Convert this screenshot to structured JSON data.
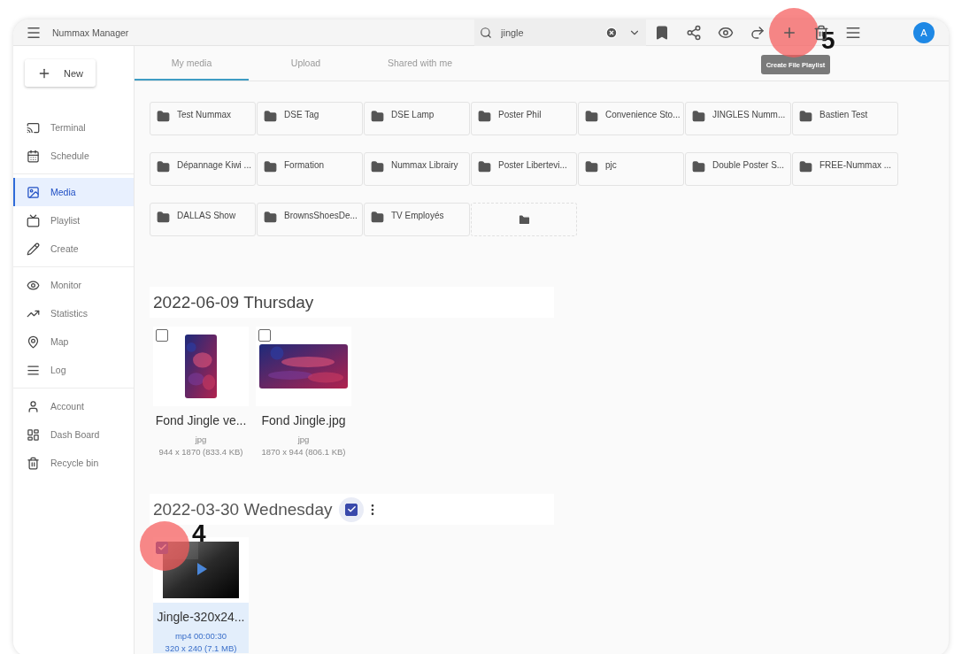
{
  "app": {
    "title": "Nummax Manager"
  },
  "search": {
    "value": "jingle"
  },
  "toolbar": {
    "avatar": "A",
    "tooltip": "Create File Playlist"
  },
  "new_button": {
    "label": "New"
  },
  "sidebar": {
    "groups": [
      {
        "items": [
          {
            "label": "Terminal",
            "selected": false
          },
          {
            "label": "Schedule",
            "selected": false
          }
        ]
      },
      {
        "items": [
          {
            "label": "Media",
            "selected": true
          },
          {
            "label": "Playlist",
            "selected": false
          },
          {
            "label": "Create",
            "selected": false
          }
        ]
      },
      {
        "items": [
          {
            "label": "Monitor",
            "selected": false
          },
          {
            "label": "Statistics",
            "selected": false
          },
          {
            "label": "Map",
            "selected": false
          },
          {
            "label": "Log",
            "selected": false
          }
        ]
      },
      {
        "items": [
          {
            "label": "Account",
            "selected": false
          },
          {
            "label": "Dash Board",
            "selected": false
          },
          {
            "label": "Recycle bin",
            "selected": false
          }
        ]
      }
    ]
  },
  "tabs": [
    {
      "label": "My media",
      "selected": true
    },
    {
      "label": "Upload",
      "selected": false
    },
    {
      "label": "Shared with me",
      "selected": false
    }
  ],
  "folders": [
    {
      "name": "Test Nummax"
    },
    {
      "name": "DSE Tag"
    },
    {
      "name": "DSE Lamp"
    },
    {
      "name": "Poster Phil"
    },
    {
      "name": "Convenience Sto..."
    },
    {
      "name": "JINGLES Numm..."
    },
    {
      "name": "Bastien Test"
    },
    {
      "name": "Dépannage Kiwi ..."
    },
    {
      "name": "Formation"
    },
    {
      "name": "Nummax Librairy"
    },
    {
      "name": "Poster Libertevi..."
    },
    {
      "name": "pjc"
    },
    {
      "name": "Double Poster S..."
    },
    {
      "name": "FREE-Nummax ..."
    },
    {
      "name": "DALLAS Show"
    },
    {
      "name": "BrownsShoesDe..."
    },
    {
      "name": "TV Employés"
    }
  ],
  "media_groups": [
    {
      "date": "2022-06-09 Thursday",
      "items": [
        {
          "kind": "portrait",
          "name": "Fond Jingle ve...",
          "info": "jpg",
          "meta": "944 x 1870 (833.4 KB)",
          "checked": false,
          "selected": false
        },
        {
          "kind": "landscape",
          "name": "Fond Jingle.jpg",
          "info": "jpg",
          "meta": "1870 x 944 (806.1 KB)",
          "checked": false,
          "selected": false
        }
      ]
    },
    {
      "date": "2022-03-30 Wednesday",
      "checked": true,
      "items": [
        {
          "kind": "video",
          "name": "Jingle-320x24...",
          "info": "mp4 00:00:30",
          "meta": "320 x 240 (7.1 MB)",
          "checked": true,
          "selected": true
        }
      ]
    }
  ],
  "annotations": [
    {
      "label": "5"
    },
    {
      "label": "4"
    }
  ]
}
